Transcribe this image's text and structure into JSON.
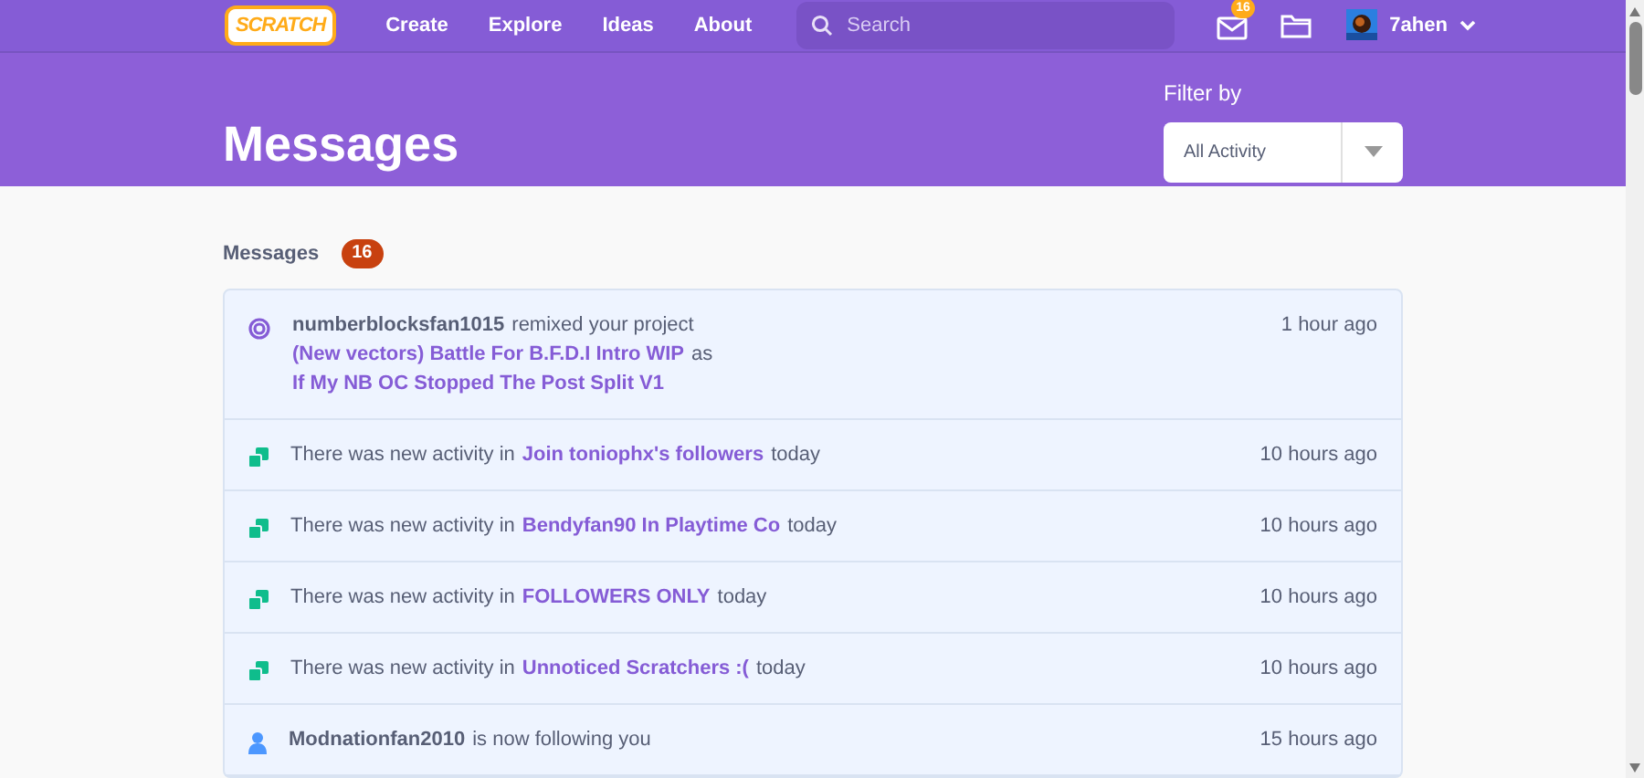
{
  "nav": {
    "logo": "SCRATCH",
    "links": [
      "Create",
      "Explore",
      "Ideas",
      "About"
    ],
    "search": {
      "placeholder": "Search"
    },
    "message_count": "16",
    "username": "7ahen"
  },
  "header": {
    "title": "Messages",
    "filter_label": "Filter by",
    "filter_value": "All Activity"
  },
  "messages_heading": "Messages",
  "messages_count": "16",
  "messages": [
    {
      "kind": "remix",
      "time": "1 hour ago",
      "parts": [
        {
          "kind": "user",
          "text": "numberblocksfan1015"
        },
        {
          "kind": "plain",
          "text": "remixed your project"
        },
        {
          "kind": "link",
          "text": "(New vectors) Battle For B.F.D.I Intro WIP"
        },
        {
          "kind": "plain",
          "text": "as"
        },
        {
          "kind": "link",
          "text": "If My NB OC Stopped The Post Split V1"
        }
      ]
    },
    {
      "kind": "studio",
      "time": "10 hours ago",
      "parts": [
        {
          "kind": "plain",
          "text": "There was new activity in"
        },
        {
          "kind": "link",
          "text": "Join toniophx's followers"
        },
        {
          "kind": "plain",
          "text": "today"
        }
      ]
    },
    {
      "kind": "studio",
      "time": "10 hours ago",
      "parts": [
        {
          "kind": "plain",
          "text": "There was new activity in"
        },
        {
          "kind": "link",
          "text": "Bendyfan90 In Playtime Co"
        },
        {
          "kind": "plain",
          "text": "today"
        }
      ]
    },
    {
      "kind": "studio",
      "time": "10 hours ago",
      "parts": [
        {
          "kind": "plain",
          "text": "There was new activity in"
        },
        {
          "kind": "link",
          "text": "FOLLOWERS ONLY"
        },
        {
          "kind": "plain",
          "text": "today"
        }
      ]
    },
    {
      "kind": "studio",
      "time": "10 hours ago",
      "parts": [
        {
          "kind": "plain",
          "text": "There was new activity in"
        },
        {
          "kind": "link",
          "text": "Unnoticed Scratchers :("
        },
        {
          "kind": "plain",
          "text": "today"
        }
      ]
    },
    {
      "kind": "follow",
      "time": "15 hours ago",
      "parts": [
        {
          "kind": "user",
          "text": "Modnationfan2010"
        },
        {
          "kind": "plain",
          "text": "is now following you"
        }
      ]
    }
  ]
}
